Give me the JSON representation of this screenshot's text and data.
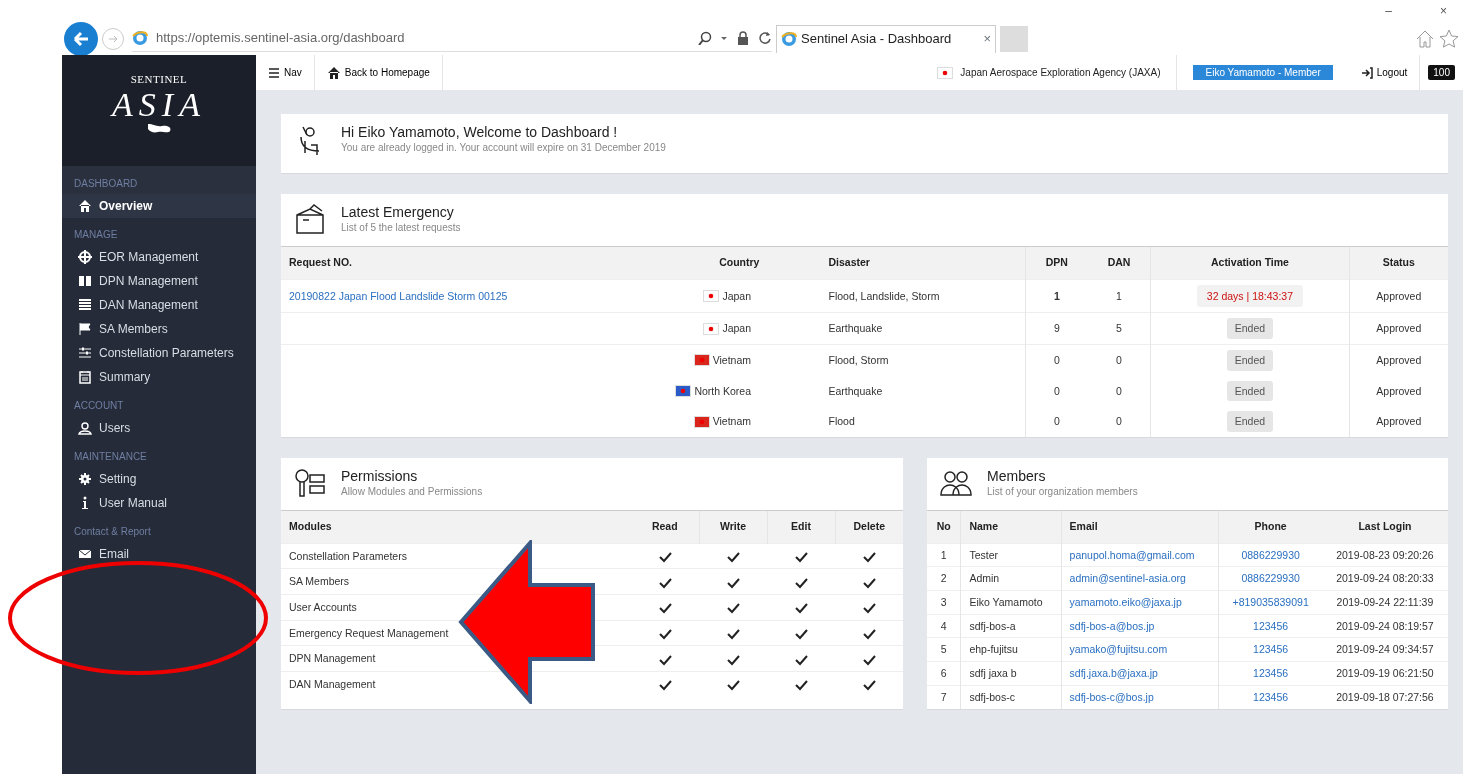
{
  "browser": {
    "url": "https://optemis.sentinel-asia.org/dashboard",
    "tab_title": "Sentinel Asia - Dashboard",
    "tab_close": "×",
    "window_controls": [
      "–",
      "×"
    ]
  },
  "topbar": {
    "nav": "Nav",
    "back": "Back to Homepage",
    "org": "Japan Aerospace Exploration Agency (JAXA)",
    "org_flag": {
      "color": "#ffffff"
    },
    "user": "Eiko Yamamoto - Member",
    "logout": "Logout",
    "counter": "100"
  },
  "sidebar": {
    "logo_top": "SENTINEL",
    "logo_main": "ASIA",
    "sections": [
      {
        "heading": "DASHBOARD",
        "items": [
          {
            "label": "Overview",
            "selected": true
          }
        ]
      },
      {
        "heading": "MANAGE",
        "items": [
          {
            "label": "EOR Management",
            "selected": false
          },
          {
            "label": "DPN Management",
            "selected": false
          },
          {
            "label": "DAN Management",
            "selected": false
          },
          {
            "label": "SA Members",
            "selected": false
          },
          {
            "label": "Constellation Parameters",
            "selected": false
          },
          {
            "label": "Summary",
            "selected": false
          }
        ]
      },
      {
        "heading": "ACCOUNT",
        "items": [
          {
            "label": "Users",
            "selected": false
          }
        ]
      },
      {
        "heading": "MAINTENANCE",
        "items": [
          {
            "label": "Setting",
            "selected": false
          },
          {
            "label": "User Manual",
            "selected": false
          }
        ]
      },
      {
        "heading": "Contact & Report",
        "items": [
          {
            "label": "Email",
            "selected": false
          }
        ]
      }
    ]
  },
  "welcome": {
    "title": "Hi Eiko Yamamoto, Welcome to Dashboard !",
    "subtitle": "You are already logged in. Your account will expire on 31 December 2019"
  },
  "emergency": {
    "title": "Latest Emergency",
    "subtitle": "List of 5 the latest requests",
    "columns": [
      "Request NO.",
      "Country",
      "Disaster",
      "DPN",
      "DAN",
      "Activation Time",
      "Status"
    ],
    "rows": [
      {
        "request": "20190822 Japan Flood Landslide Storm 00125",
        "color": "#ffffff",
        "country": "Japan",
        "disaster": "Flood, Landslide, Storm",
        "dpn": "1",
        "dan": "1",
        "activation": "32 days | 18:43:37",
        "active": true,
        "status": "Approved"
      },
      {
        "color": "#ffffff",
        "country": "Japan",
        "disaster": "Earthquake",
        "dpn": "9",
        "dan": "5",
        "activation": "Ended",
        "active": false,
        "status": "Approved"
      },
      {
        "color": "#da251d",
        "country": "Vietnam",
        "disaster": "Flood, Storm",
        "dpn": "0",
        "dan": "0",
        "activation": "Ended",
        "active": false,
        "status": "Approved"
      },
      {
        "color": "#2a5bc8",
        "country": "North Korea",
        "disaster": "Earthquake",
        "dpn": "0",
        "dan": "0",
        "activation": "Ended",
        "active": false,
        "status": "Approved"
      },
      {
        "color": "#da251d",
        "country": "Vietnam",
        "disaster": "Flood",
        "dpn": "0",
        "dan": "0",
        "activation": "Ended",
        "active": false,
        "status": "Approved"
      }
    ]
  },
  "permissions": {
    "title": "Permissions",
    "subtitle": "Allow Modules and Permissions",
    "columns": [
      "Modules",
      "Read",
      "Write",
      "Edit",
      "Delete"
    ],
    "rows": [
      {
        "module": "Constellation Parameters",
        "read": true,
        "write": true,
        "edit": true,
        "delete": true
      },
      {
        "module": "SA Members",
        "read": true,
        "write": true,
        "edit": true,
        "delete": true
      },
      {
        "module": "User Accounts",
        "read": true,
        "write": true,
        "edit": true,
        "delete": true
      },
      {
        "module": "Emergency Request Management",
        "read": true,
        "write": true,
        "edit": true,
        "delete": true
      },
      {
        "module": "DPN Management",
        "read": true,
        "write": true,
        "edit": true,
        "delete": true
      },
      {
        "module": "DAN Management",
        "read": true,
        "write": true,
        "edit": true,
        "delete": true
      }
    ]
  },
  "members": {
    "title": "Members",
    "subtitle": "List of your organization members",
    "columns": [
      "No",
      "Name",
      "Email",
      "Phone",
      "Last Login"
    ],
    "rows": [
      {
        "no": "1",
        "name": "Tester",
        "email": "panupol.homa@gmail.com",
        "phone": "0886229930",
        "last_login": "2019-08-23 09:20:26"
      },
      {
        "no": "2",
        "name": "Admin",
        "email": "admin@sentinel-asia.org",
        "phone": "0886229930",
        "last_login": "2019-09-24 08:20:33"
      },
      {
        "no": "3",
        "name": "Eiko Yamamoto",
        "email": "yamamoto.eiko@jaxa.jp",
        "phone": "+819035839091",
        "last_login": "2019-09-24 22:11:39"
      },
      {
        "no": "4",
        "name": "sdfj-bos-a",
        "email": "sdfj-bos-a@bos.jp",
        "phone": "123456",
        "last_login": "2019-09-24 08:19:57"
      },
      {
        "no": "5",
        "name": "ehp-fujitsu",
        "email": "yamako@fujitsu.com",
        "phone": "123456",
        "last_login": "2019-09-24 09:34:57"
      },
      {
        "no": "6",
        "name": "sdfj jaxa b",
        "email": "sdfj.jaxa.b@jaxa.jp",
        "phone": "123456",
        "last_login": "2019-09-19 06:21:50"
      },
      {
        "no": "7",
        "name": "sdfj-bos-c",
        "email": "sdfj-bos-c@bos.jp",
        "phone": "123456",
        "last_login": "2019-09-18 07:27:56"
      }
    ]
  },
  "annotations": {
    "highlight_ellipse": true,
    "pointer_arrow": true
  }
}
